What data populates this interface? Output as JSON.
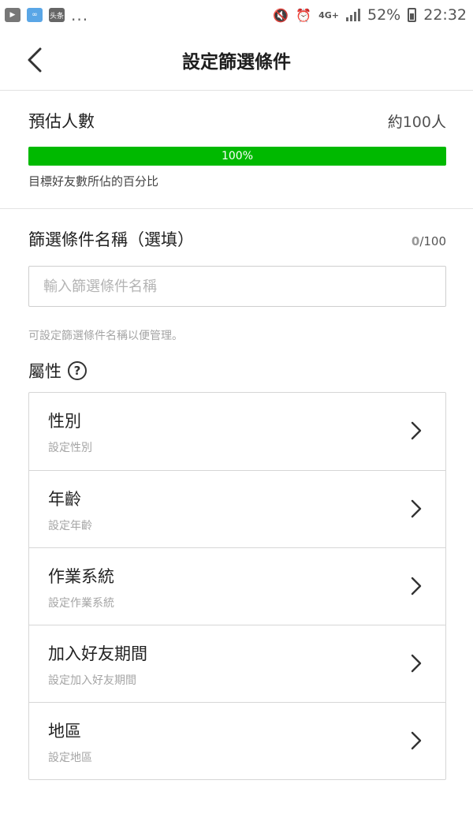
{
  "status_bar": {
    "app_badge": "头条",
    "overflow": "...",
    "network": "4G+",
    "battery": "52%",
    "time": "22:32"
  },
  "header": {
    "title": "設定篩選條件"
  },
  "estimate": {
    "label": "預估人數",
    "value_prefix": "約",
    "value_number": "100",
    "value_suffix": "人",
    "progress_percent": 100,
    "progress_label": "100%",
    "note": "目標好友數所佔的百分比"
  },
  "filter_name": {
    "label": "篩選條件名稱（選填）",
    "count_current": "0",
    "count_max": "/100",
    "placeholder": "輸入篩選條件名稱",
    "value": "",
    "hint": "可設定篩選條件名稱以便管理。"
  },
  "attributes": {
    "label": "屬性",
    "help": "?",
    "items": [
      {
        "name": "性別",
        "sub": "設定性別"
      },
      {
        "name": "年齡",
        "sub": "設定年齡"
      },
      {
        "name": "作業系統",
        "sub": "設定作業系統"
      },
      {
        "name": "加入好友期間",
        "sub": "設定加入好友期間"
      },
      {
        "name": "地區",
        "sub": "設定地區"
      }
    ]
  },
  "colors": {
    "accent_green": "#00b900"
  }
}
